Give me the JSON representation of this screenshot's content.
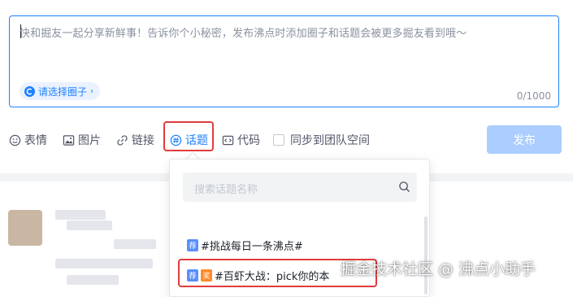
{
  "editor": {
    "placeholder": "快和掘友一起分享新鲜事！告诉你个小秘密，发布沸点时添加圈子和话题会被更多掘友看到哦～",
    "circle_pill_label": "请选择圈子",
    "circle_pill_chevron": "›",
    "char_count": "0/1000"
  },
  "toolbar": {
    "emoji_label": "表情",
    "image_label": "图片",
    "link_label": "链接",
    "topic_label": "话题",
    "code_label": "代码",
    "sync_label": "同步到团队空间",
    "publish_label": "发布"
  },
  "topic_dropdown": {
    "search_placeholder": "搜索话题名称",
    "items": [
      {
        "tags": [
          "荐"
        ],
        "label": "#挑战每日一条沸点#"
      },
      {
        "tags": [
          "荐",
          "奖"
        ],
        "label": "#百虾大战：pick你的本"
      }
    ]
  },
  "watermark": "掘金技术社区 @ 沸点小助手",
  "colors": {
    "accent": "#1e80ff",
    "publish_disabled": "#abcdff",
    "highlight_frame": "#e03c3c",
    "tag_recommend": "#5b8ff9",
    "tag_award": "#ff8a2b"
  }
}
